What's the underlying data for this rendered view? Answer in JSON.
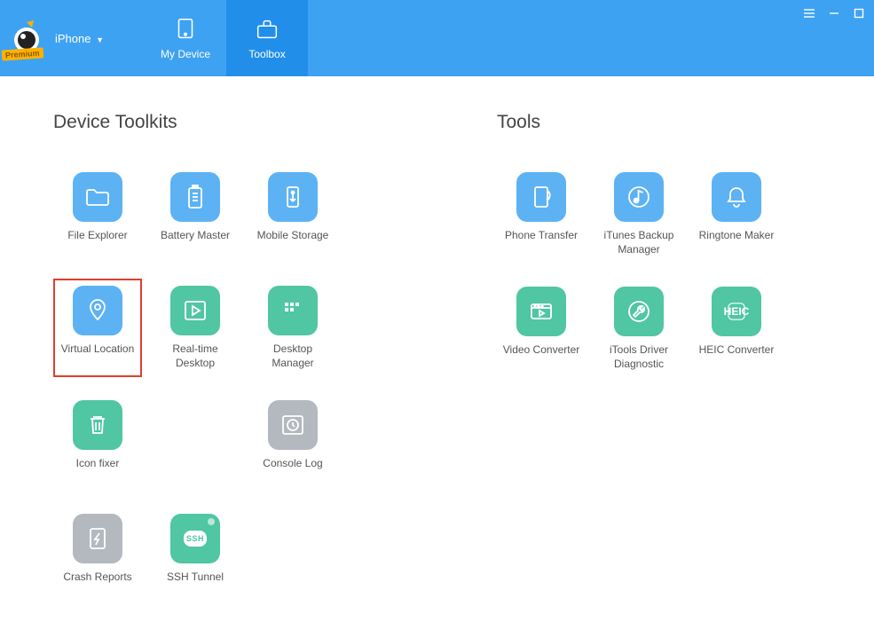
{
  "brand": {
    "premium_label": "Premium"
  },
  "device_selector": {
    "label": "iPhone"
  },
  "nav": {
    "my_device": "My Device",
    "toolbox": "Toolbox"
  },
  "sections": {
    "device_toolkits_title": "Device Toolkits",
    "tools_title": "Tools"
  },
  "device_toolkits": {
    "file_explorer": "File Explorer",
    "battery_master": "Battery Master",
    "mobile_storage": "Mobile Storage",
    "virtual_location": "Virtual Location",
    "realtime_desktop": "Real-time Desktop",
    "desktop_manager": "Desktop Manager",
    "icon_fixer": "Icon fixer",
    "console_log": "Console Log",
    "crash_reports": "Crash Reports",
    "ssh_tunnel": "SSH Tunnel",
    "ssh_badge": "SSH"
  },
  "tools": {
    "phone_transfer": "Phone Transfer",
    "itunes_backup": "iTunes Backup Manager",
    "ringtone_maker": "Ringtone Maker",
    "video_converter": "Video Converter",
    "driver_diagnostic": "iTools Driver Diagnostic",
    "heic_converter": "HEIC Converter",
    "heic_badge": "HEIC"
  }
}
